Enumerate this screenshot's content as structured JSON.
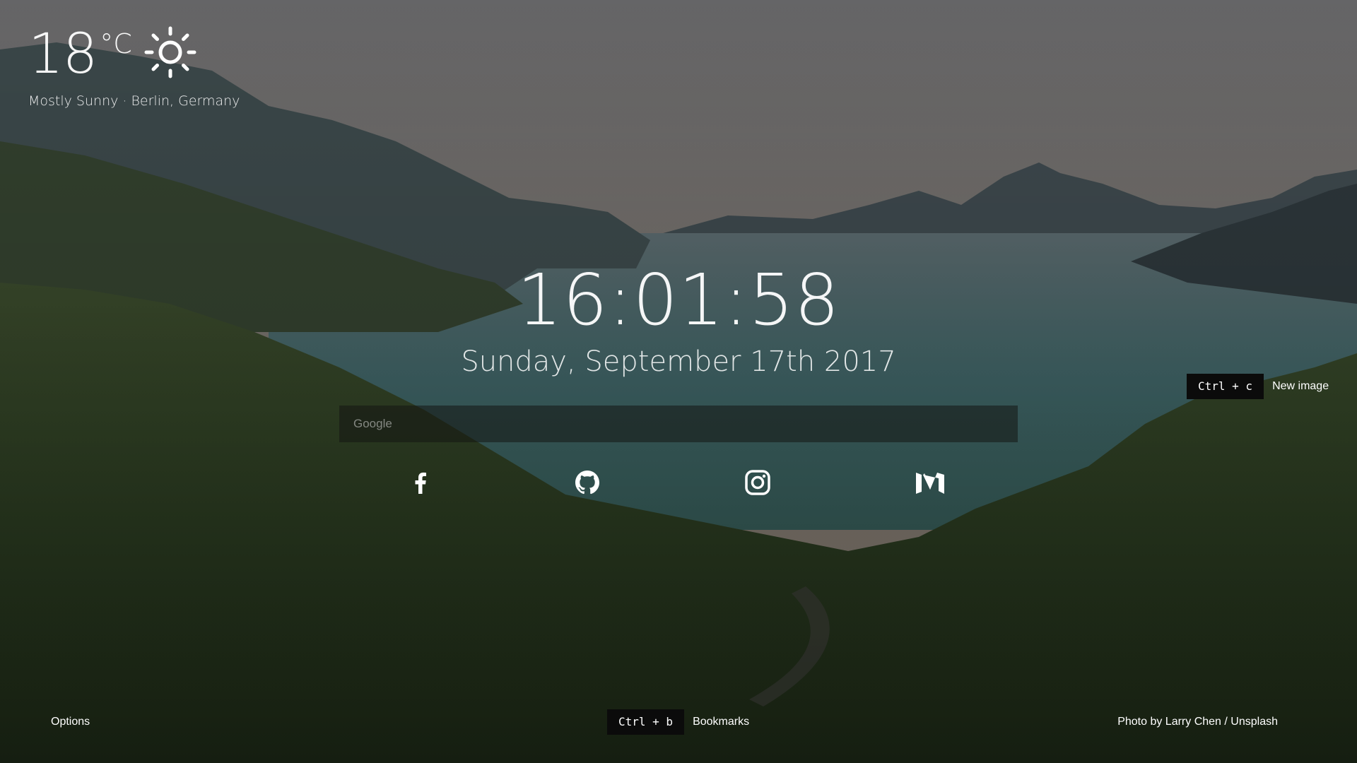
{
  "weather": {
    "temperature": "18",
    "unit": "°C",
    "condition_icon": "sun-icon",
    "description": "Mostly Sunny · Berlin, Germany"
  },
  "clock": {
    "time": "16:01:58",
    "date": "Sunday, September 17th 2017"
  },
  "search": {
    "placeholder": "Google",
    "value": ""
  },
  "social_links": [
    {
      "name": "facebook-icon"
    },
    {
      "name": "github-icon"
    },
    {
      "name": "instagram-icon"
    },
    {
      "name": "medium-icon"
    }
  ],
  "shortcuts": {
    "new_image": {
      "keys": "Ctrl + c",
      "label": "New image"
    },
    "bookmarks": {
      "keys": "Ctrl + b",
      "label": "Bookmarks"
    }
  },
  "footer": {
    "options_label": "Options",
    "credit_prefix": "Photo by ",
    "photographer": "Larry Chen",
    "separator": " / ",
    "source": "Unsplash"
  },
  "colors": {
    "kbd_background": "#0b0b0b",
    "search_background": "#141612"
  }
}
